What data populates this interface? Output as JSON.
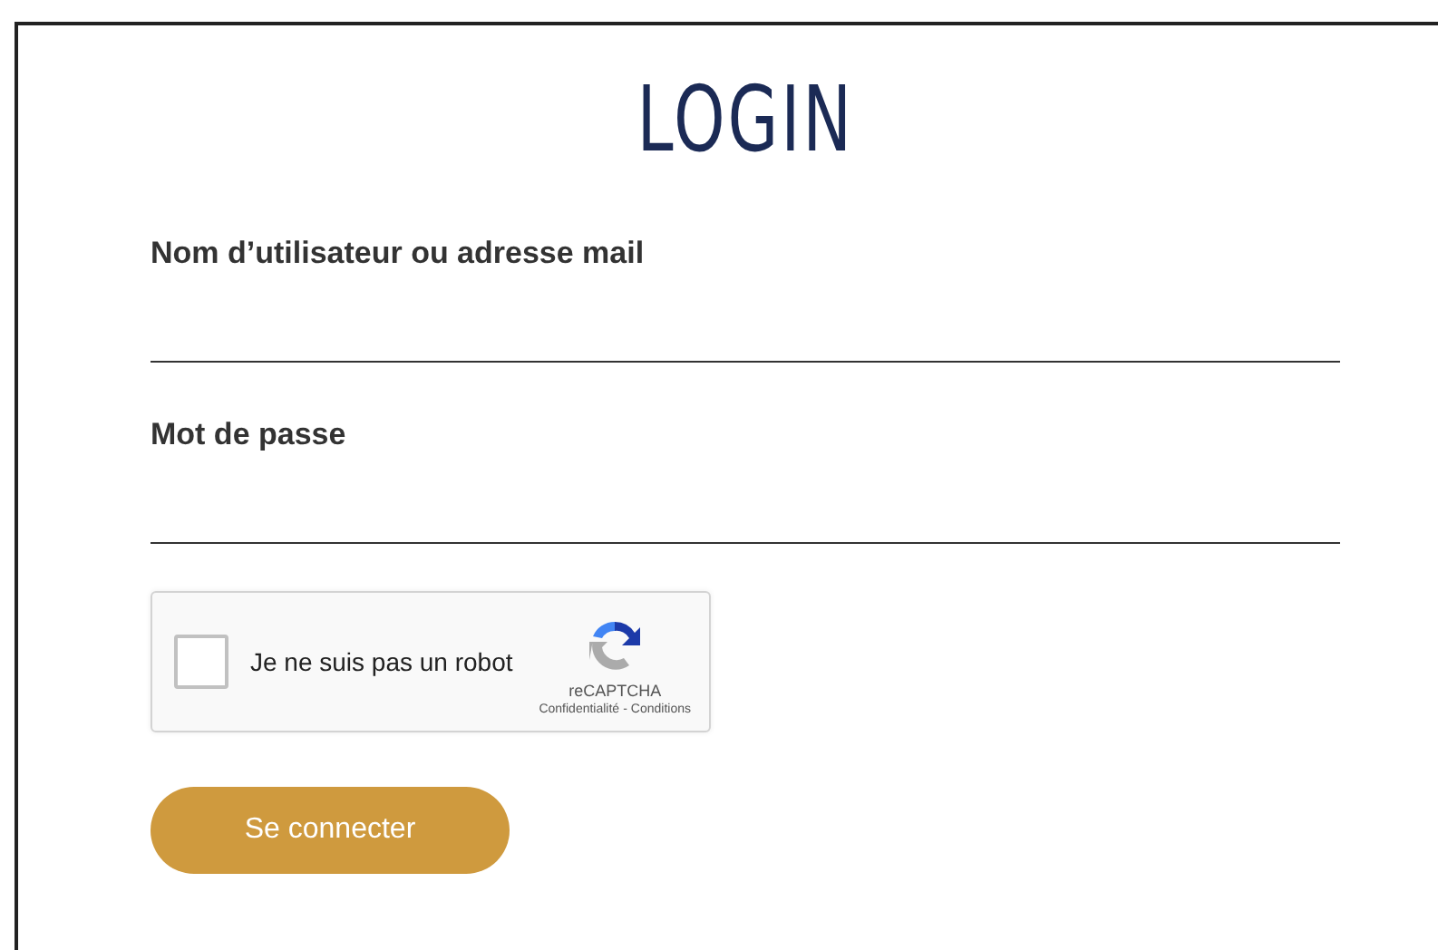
{
  "title": "LOGIN",
  "fields": [
    {
      "label": "Nom d’utilisateur ou adresse mail"
    },
    {
      "label": "Mot de passe"
    }
  ],
  "captcha": {
    "label": "Je ne suis pas un robot",
    "checked": false,
    "brand": "reCAPTCHA",
    "privacy": "Confidentialité",
    "separator": "-",
    "terms": "Conditions"
  },
  "submit": "Se connecter"
}
